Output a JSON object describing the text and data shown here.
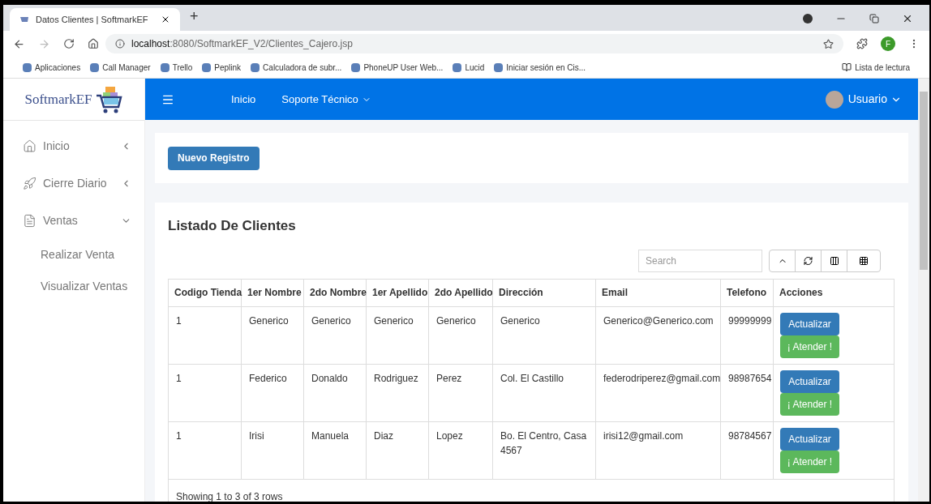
{
  "browser": {
    "tab_title": "Datos Clientes | SoftmarkEF",
    "new_tab": "+",
    "url_host": "localhost",
    "url_rest": ":8080/SoftmarkEF_V2/Clientes_Cajero.jsp",
    "profile_initial": "F",
    "bookmarks": [
      "Aplicaciones",
      "Call Manager",
      "Trello",
      "Peplink",
      "Calculadora de subr...",
      "PhoneUP User Web...",
      "Lucid",
      "Iniciar sesión en Cis..."
    ],
    "reading_list": "Lista de lectura"
  },
  "brand": "SoftmarkEF",
  "sidebar": {
    "items": [
      {
        "label": "Inicio",
        "expanded": false
      },
      {
        "label": "Cierre Diario",
        "expanded": false
      },
      {
        "label": "Ventas",
        "expanded": true,
        "children": [
          {
            "label": "Realizar Venta"
          },
          {
            "label": "Visualizar Ventas"
          }
        ]
      }
    ]
  },
  "topbar": {
    "links": [
      {
        "label": "Inicio",
        "dropdown": false
      },
      {
        "label": "Soporte Técnico",
        "dropdown": true
      }
    ],
    "user": "Usuario"
  },
  "new_button": "Nuevo Registro",
  "list": {
    "title": "Listado De Clientes",
    "search": {
      "placeholder": "Search"
    },
    "columns": [
      "Codigo Tienda",
      "1er Nombre",
      "2do Nombre",
      "1er Apellido",
      "2do Apellido",
      "Dirección",
      "Email",
      "Telefono",
      "Acciones"
    ],
    "rows": [
      {
        "cells": [
          "1",
          "Generico",
          "Generico",
          "Generico",
          "Generico",
          "Generico",
          "Generico@Generico.com",
          "99999999"
        ],
        "actions": [
          "Actualizar",
          "¡ Atender !"
        ]
      },
      {
        "cells": [
          "1",
          "Federico",
          "Donaldo",
          "Rodriguez",
          "Perez",
          "Col. El Castillo",
          "federodriperez@gmail.com",
          "98987654"
        ],
        "actions": [
          "Actualizar",
          "¡ Atender !"
        ]
      },
      {
        "cells": [
          "1",
          "Irisi",
          "Manuela",
          "Diaz",
          "Lopez",
          "Bo. El Centro, Casa 4567",
          "irisi12@gmail.com",
          "98784567"
        ],
        "actions": [
          "Actualizar",
          "¡ Atender !"
        ]
      }
    ],
    "footer": "Showing 1 to 3 of 3 rows"
  }
}
